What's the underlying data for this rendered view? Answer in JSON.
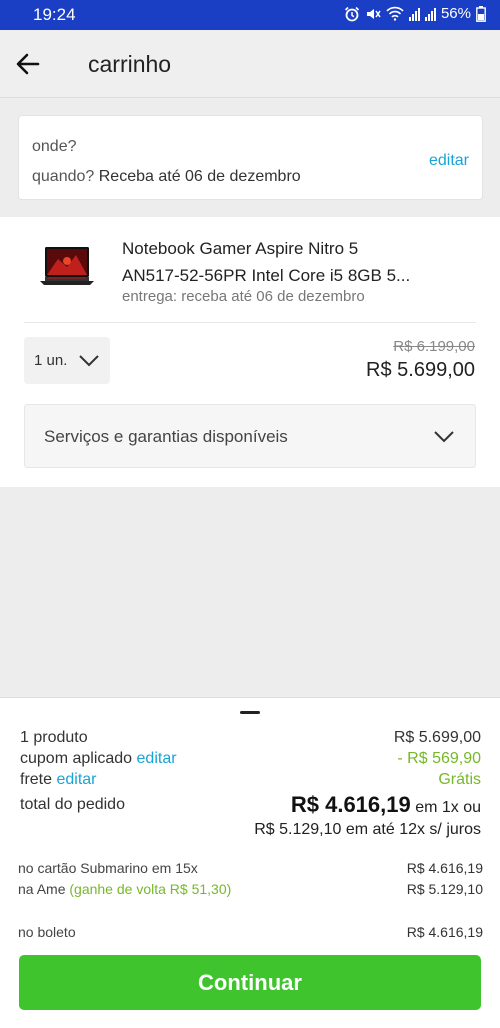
{
  "status_bar": {
    "time": "19:24",
    "battery": "56%"
  },
  "header": {
    "title": "carrinho",
    "back_icon": "arrow-left-icon"
  },
  "delivery": {
    "where_label": "onde?",
    "when_label": "quando?",
    "when_value": "Receba até 06 de dezembro",
    "edit_label": "editar"
  },
  "product": {
    "name_line1": "Notebook Gamer Aspire Nitro 5",
    "name_line2": "AN517-52-56PR Intel Core i5 8GB 5...",
    "delivery": "entrega: receba até 06 de dezembro",
    "quantity": "1 un.",
    "old_price": "R$ 6.199,00",
    "price": "R$ 5.699,00",
    "services_label": "Serviços e garantias disponíveis"
  },
  "summary": {
    "products_label": "1 produto",
    "products_value": "R$ 5.699,00",
    "coupon_label": "cupom aplicado",
    "coupon_edit": "editar",
    "coupon_value": "- R$ 569,90",
    "shipping_label": "frete",
    "shipping_edit": "editar",
    "shipping_value": "Grátis",
    "total_label": "total do pedido",
    "total_value": "R$ 4.616,19",
    "total_suffix": "em 1x ou",
    "installments": "R$ 5.129,10 em até 12x s/ juros"
  },
  "payment_options": {
    "card_label": "no cartão Submarino em 15x",
    "card_value": "R$ 4.616,19",
    "ame_label": "na Ame",
    "ame_cashback": "(ganhe de volta R$ 51,30)",
    "ame_value": "R$ 5.129,10",
    "boleto_label": "no boleto",
    "boleto_value": "R$ 4.616,19"
  },
  "continue_label": "Continuar",
  "colors": {
    "status_bar": "#1a3fc4",
    "link": "#1aa3d6",
    "discount": "#76b82a",
    "button": "#3fc42e"
  }
}
